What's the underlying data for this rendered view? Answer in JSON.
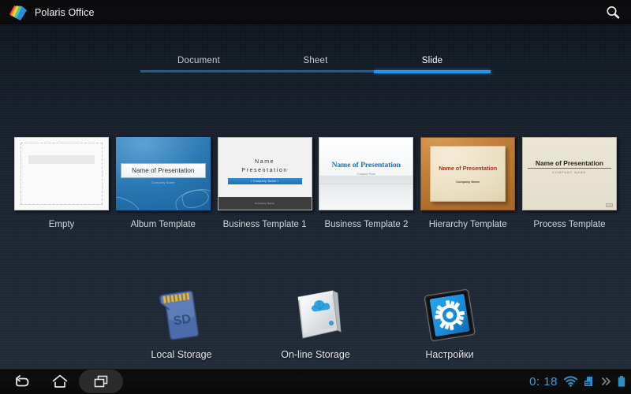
{
  "window": {
    "app_title": "Polaris Office",
    "logo_icon": "polaris-office-logo",
    "search_icon": "search-icon"
  },
  "tabs": [
    {
      "label": "Document",
      "active": false
    },
    {
      "label": "Sheet",
      "active": false
    },
    {
      "label": "Slide",
      "active": true
    }
  ],
  "colors": {
    "accent_active": "#2196f3",
    "accent_inactive": "#1b5f96",
    "background": "#1a2330",
    "topbar": "#0b0b0e",
    "status_text": "#3f9fd4"
  },
  "templates": [
    {
      "label": "Empty",
      "kind": "empty",
      "preview": {
        "title": "",
        "subtitle": ""
      }
    },
    {
      "label": "Album Template",
      "kind": "album",
      "preview": {
        "title": "Name of Presentation",
        "subtitle": "Company Name"
      }
    },
    {
      "label": "Business Template 1",
      "kind": "business1",
      "preview": {
        "title_line1": "Name",
        "title_line2": "Presentation",
        "band": "▪ Company Name ▪",
        "footer": "Company Name"
      }
    },
    {
      "label": "Business Template 2",
      "kind": "business2",
      "preview": {
        "title": "Name of Presentation",
        "subtitle": "Company Name"
      }
    },
    {
      "label": "Hierarchy Template",
      "kind": "hierarchy",
      "preview": {
        "title": "Name of Presentation",
        "subtitle": "Company Name"
      }
    },
    {
      "label": "Process Template",
      "kind": "process",
      "preview": {
        "title": "Name of Presentation",
        "subtitle": "COMPANY NAME"
      }
    }
  ],
  "storage": [
    {
      "label": "Local Storage",
      "icon": "sd-card-icon",
      "badge_text": "SD"
    },
    {
      "label": "On-line Storage",
      "icon": "cloud-drive-icon",
      "badge_text": ""
    },
    {
      "label": "Настройки",
      "icon": "settings-tablet-gear-icon",
      "badge_text": ""
    }
  ],
  "navbar": {
    "back_icon": "back-arrow-icon",
    "home_icon": "home-icon",
    "recents_icon": "recent-apps-icon",
    "clock": "0: 18",
    "wifi_icon": "wifi-icon",
    "keyboard_icon": "keyboard-icon",
    "expand_icon": "double-chevron-right-icon",
    "battery_icon": "battery-icon"
  }
}
